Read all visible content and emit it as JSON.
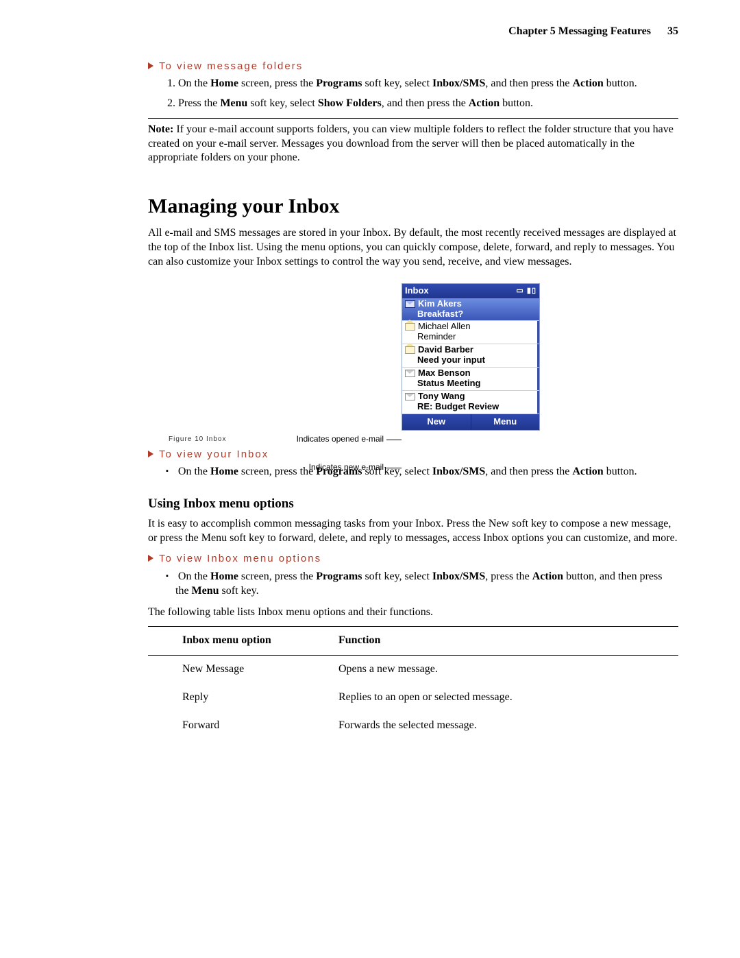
{
  "header": {
    "chapter": "Chapter 5",
    "title": "Messaging Features",
    "page": "35"
  },
  "section_view_folders": {
    "heading": "To view message folders",
    "step1_a": "On the ",
    "step1_b": "Home",
    "step1_c": " screen, press the ",
    "step1_d": "Programs",
    "step1_e": " soft key, select ",
    "step1_f": "Inbox/SMS",
    "step1_g": ", and then press the ",
    "step1_h": "Action",
    "step1_i": " button.",
    "step2_a": "Press the ",
    "step2_b": "Menu",
    "step2_c": " soft key, select ",
    "step2_d": "Show Folders",
    "step2_e": ", and then press the ",
    "step2_f": "Action",
    "step2_g": " button."
  },
  "note": {
    "label": "Note:",
    "text": " If your e-mail account supports folders, you can view multiple folders to reflect the folder structure that you have created on your e-mail server. Messages you download from the server will then be placed automatically in the appropriate folders on your phone."
  },
  "main_heading": "Managing your Inbox",
  "intro_body": "All e-mail and SMS messages are stored in your Inbox. By default, the most recently received messages are displayed at the top of the Inbox list. Using the menu options, you can quickly compose, delete, forward, and reply to messages. You can also customize your Inbox settings to control the way you send, receive, and view messages.",
  "figure": {
    "callout_opened": "Indicates opened e-mail",
    "callout_new": "Indicates new e-mail",
    "titlebar": "Inbox",
    "rows": [
      {
        "sender": "Kim Akers",
        "subject": "Breakfast?",
        "icon": "closed-sel",
        "selected": true,
        "bold": true
      },
      {
        "sender": "Michael Allen",
        "subject": "Reminder",
        "icon": "open",
        "selected": false,
        "bold": false
      },
      {
        "sender": "David Barber",
        "subject": "Need your input",
        "icon": "open",
        "selected": false,
        "bold": true
      },
      {
        "sender": "Max Benson",
        "subject": "Status Meeting",
        "icon": "closed",
        "selected": false,
        "bold": true
      },
      {
        "sender": "Tony Wang",
        "subject": "RE: Budget Review",
        "icon": "closed",
        "selected": false,
        "bold": true
      }
    ],
    "soft_left": "New",
    "soft_right": "Menu",
    "caption": "Figure 10 Inbox"
  },
  "section_view_inbox": {
    "heading": "To view your Inbox",
    "b1_a": "On the ",
    "b1_b": "Home",
    "b1_c": " screen, press the ",
    "b1_d": "Programs",
    "b1_e": " soft key, select ",
    "b1_f": "Inbox/SMS",
    "b1_g": ", and then press the ",
    "b1_h": "Action",
    "b1_i": " button."
  },
  "using_heading": "Using Inbox menu options",
  "using_body": "It is easy to accomplish common messaging tasks from your Inbox. Press the New soft key to compose a new message, or press the Menu soft key to forward, delete, and reply to messages, access Inbox options you can customize, and more.",
  "section_view_opts": {
    "heading": "To view Inbox menu options",
    "b1_a": "On the ",
    "b1_b": "Home",
    "b1_c": " screen, press the ",
    "b1_d": "Programs",
    "b1_e": " soft key, select ",
    "b1_f": "Inbox/SMS",
    "b1_g": ", press the ",
    "b1_h": "Action",
    "b1_i": " button, and then press the ",
    "b1_j": "Menu",
    "b1_k": " soft key."
  },
  "table_intro": "The following table lists Inbox menu options and their functions.",
  "table": {
    "col1": "Inbox menu option",
    "col2": "Function",
    "rows": [
      {
        "opt": "New Message",
        "fn": "Opens a new message."
      },
      {
        "opt": "Reply",
        "fn": "Replies to an open or selected message."
      },
      {
        "opt": "Forward",
        "fn": "Forwards the selected message."
      }
    ]
  }
}
